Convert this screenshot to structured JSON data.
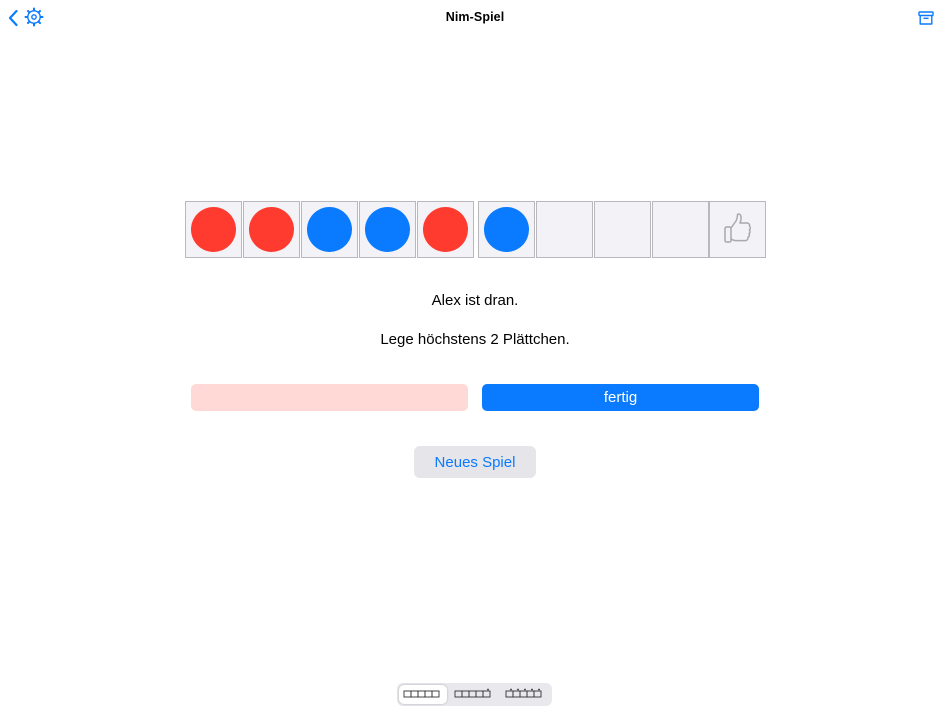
{
  "header": {
    "title": "Nim-Spiel",
    "back_icon": "chevron-left-icon",
    "settings_icon": "gear-icon",
    "archive_icon": "archive-box-icon"
  },
  "board": {
    "cells": [
      {
        "token": "red"
      },
      {
        "token": "red"
      },
      {
        "token": "blue"
      },
      {
        "token": "blue"
      },
      {
        "token": "red"
      },
      {
        "token": "blue"
      },
      {
        "token": "empty"
      },
      {
        "token": "empty"
      },
      {
        "token": "empty"
      },
      {
        "token": "goal",
        "icon": "thumbs-up-icon"
      }
    ]
  },
  "status": {
    "turn": "Alex ist dran.",
    "instruction": "Lege höchstens 2 Plättchen."
  },
  "actions": {
    "left_label": "",
    "done_label": "fertig",
    "new_game_label": "Neues Spiel"
  },
  "mode_selector": {
    "options": [
      "ten-boxes-icon",
      "ten-boxes-marked-end-icon",
      "ten-boxes-marked-all-icon"
    ],
    "selected_index": 0
  },
  "colors": {
    "red": "#ff3b30",
    "blue": "#0a7aff",
    "accent": "#0a7aff",
    "left_button_bg": "#ffd9d6",
    "cell_bg": "#f2f2f7"
  }
}
